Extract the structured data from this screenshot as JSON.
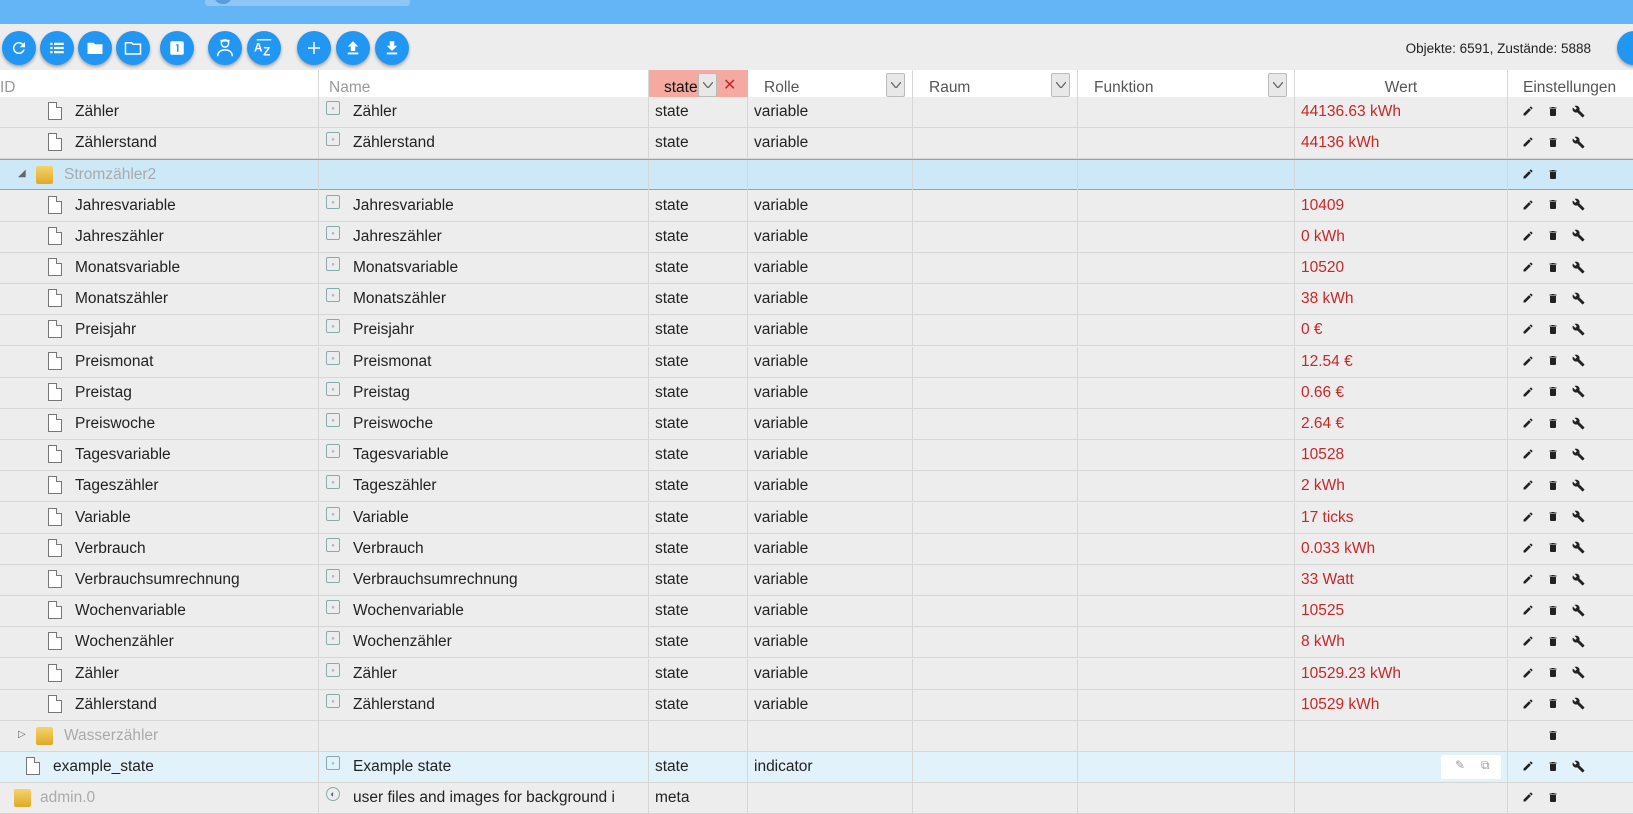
{
  "toolbar": {
    "buttons": [
      {
        "name": "refresh-button",
        "icon": "refresh-icon"
      },
      {
        "name": "list-view-button",
        "icon": "list-icon"
      },
      {
        "name": "folder-button",
        "icon": "folder-icon"
      },
      {
        "name": "folder-open-button",
        "icon": "folder-outline-icon"
      },
      {
        "name": "one-level-button",
        "icon": "numbered-1-icon"
      },
      {
        "name": "expert-mode-button",
        "icon": "expert-icon"
      },
      {
        "name": "sort-az-button",
        "icon": "sort-az-icon"
      },
      {
        "name": "add-button",
        "icon": "plus-icon"
      },
      {
        "name": "upload-button",
        "icon": "upload-icon"
      },
      {
        "name": "download-button",
        "icon": "download-icon"
      }
    ],
    "stats": "Objekte: 6591, Zustände: 5888",
    "accent": "#2196f3"
  },
  "columns": {
    "id": "ID",
    "name": "Name",
    "type_filter": "state",
    "role": "Rolle",
    "room": "Raum",
    "function": "Funktion",
    "value": "Wert",
    "settings": "Einstellungen"
  },
  "rows": [
    {
      "kind": "state",
      "id": "Zähler",
      "name": "Zähler",
      "type": "state",
      "role": "variable",
      "value": "44136.63 kWh"
    },
    {
      "kind": "state",
      "id": "Zählerstand",
      "name": "Zählerstand",
      "type": "state",
      "role": "variable",
      "value": "44136 kWh"
    },
    {
      "kind": "folder",
      "id": "Stromzähler2",
      "expanded": true,
      "selected": true
    },
    {
      "kind": "state",
      "id": "Jahresvariable",
      "name": "Jahresvariable",
      "type": "state",
      "role": "variable",
      "value": "10409"
    },
    {
      "kind": "state",
      "id": "Jahreszähler",
      "name": "Jahreszähler",
      "type": "state",
      "role": "variable",
      "value": "0 kWh"
    },
    {
      "kind": "state",
      "id": "Monatsvariable",
      "name": "Monatsvariable",
      "type": "state",
      "role": "variable",
      "value": "10520"
    },
    {
      "kind": "state",
      "id": "Monatszähler",
      "name": "Monatszähler",
      "type": "state",
      "role": "variable",
      "value": "38 kWh"
    },
    {
      "kind": "state",
      "id": "Preisjahr",
      "name": "Preisjahr",
      "type": "state",
      "role": "variable",
      "value": "0 €"
    },
    {
      "kind": "state",
      "id": "Preismonat",
      "name": "Preismonat",
      "type": "state",
      "role": "variable",
      "value": "12.54 €"
    },
    {
      "kind": "state",
      "id": "Preistag",
      "name": "Preistag",
      "type": "state",
      "role": "variable",
      "value": "0.66 €"
    },
    {
      "kind": "state",
      "id": "Preiswoche",
      "name": "Preiswoche",
      "type": "state",
      "role": "variable",
      "value": "2.64 €"
    },
    {
      "kind": "state",
      "id": "Tagesvariable",
      "name": "Tagesvariable",
      "type": "state",
      "role": "variable",
      "value": "10528"
    },
    {
      "kind": "state",
      "id": "Tageszähler",
      "name": "Tageszähler",
      "type": "state",
      "role": "variable",
      "value": "2 kWh"
    },
    {
      "kind": "state",
      "id": "Variable",
      "name": "Variable",
      "type": "state",
      "role": "variable",
      "value": "17 ticks"
    },
    {
      "kind": "state",
      "id": "Verbrauch",
      "name": "Verbrauch",
      "type": "state",
      "role": "variable",
      "value": "0.033 kWh"
    },
    {
      "kind": "state",
      "id": "Verbrauchsumrechnung",
      "name": "Verbrauchsumrechnung",
      "type": "state",
      "role": "variable",
      "value": "33 Watt"
    },
    {
      "kind": "state",
      "id": "Wochenvariable",
      "name": "Wochenvariable",
      "type": "state",
      "role": "variable",
      "value": "10525"
    },
    {
      "kind": "state",
      "id": "Wochenzähler",
      "name": "Wochenzähler",
      "type": "state",
      "role": "variable",
      "value": "8 kWh"
    },
    {
      "kind": "state",
      "id": "Zähler",
      "name": "Zähler",
      "type": "state",
      "role": "variable",
      "value": "10529.23 kWh"
    },
    {
      "kind": "state",
      "id": "Zählerstand",
      "name": "Zählerstand",
      "type": "state",
      "role": "variable",
      "value": "10529 kWh"
    },
    {
      "kind": "folder",
      "id": "Wasserzähler",
      "expanded": false
    },
    {
      "kind": "state-root",
      "id": "example_state",
      "name": "Example state",
      "type": "state",
      "role": "indicator",
      "value": "",
      "hover": true
    },
    {
      "kind": "meta-partial",
      "id": "admin.0",
      "name": "user files and images for background i",
      "type": "meta"
    }
  ]
}
